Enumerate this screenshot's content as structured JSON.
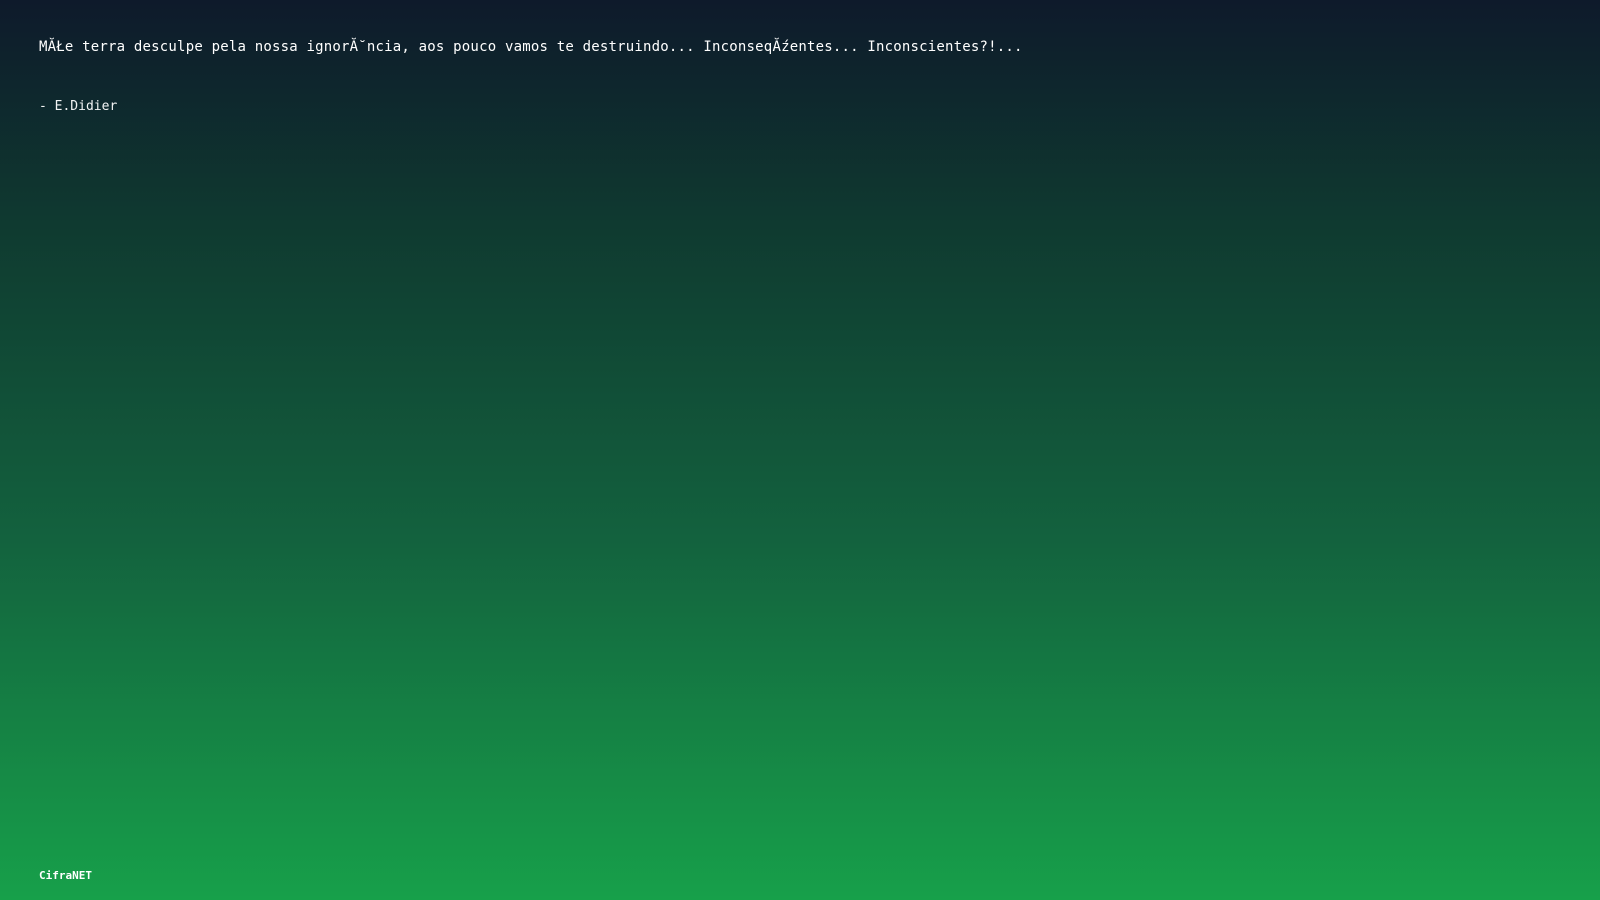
{
  "quote": {
    "text": "MĂŁe terra desculpe pela nossa ignorĂ˘ncia, aos pouco vamos te destruindo... InconseqĂźentes... Inconscientes?!...",
    "author": "- E.Didier"
  },
  "brand": {
    "name": "CifraNET"
  }
}
